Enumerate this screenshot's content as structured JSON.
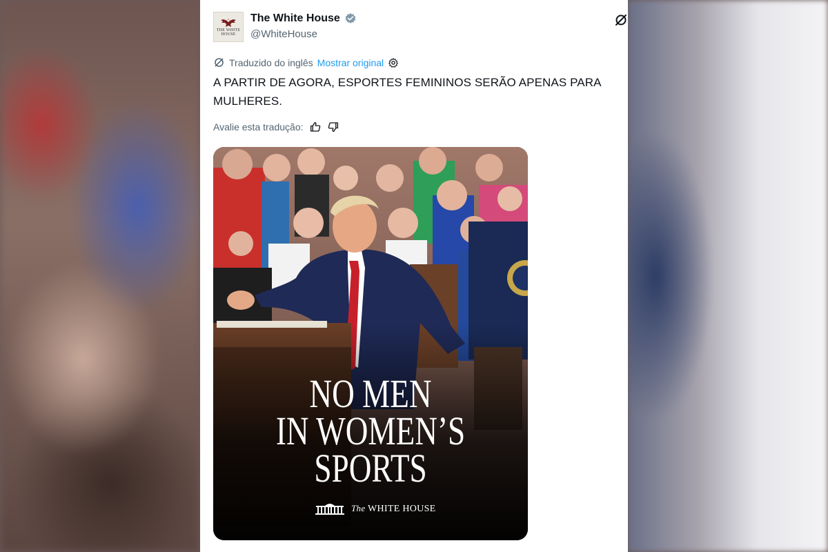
{
  "colors": {
    "link": "#1d9bf0",
    "text": "#0f1419",
    "muted": "#536471",
    "verified_badge": "#829aab"
  },
  "tweet": {
    "author_name": "The White House",
    "author_handle": "@WhiteHouse",
    "avatar_text": "THE WHITE HOUSE",
    "verified": true,
    "translated_label": "Traduzido do inglês",
    "show_original_label": "Mostrar original",
    "text": "A PARTIR DE AGORA, ESPORTES FEMININOS SERÃO APENAS PARA MULHERES.",
    "rate_translation_label": "Avalie esta tradução:",
    "icons": [
      "translate-icon",
      "settings-icon",
      "thumbs-up-icon",
      "thumbs-down-icon",
      "grok-icon"
    ]
  },
  "media": {
    "headline_lines": [
      "NO MEN",
      "IN WOMEN’S",
      "SPORTS"
    ],
    "brand_prefix": "The",
    "brand_name": "WHITE HOUSE"
  }
}
